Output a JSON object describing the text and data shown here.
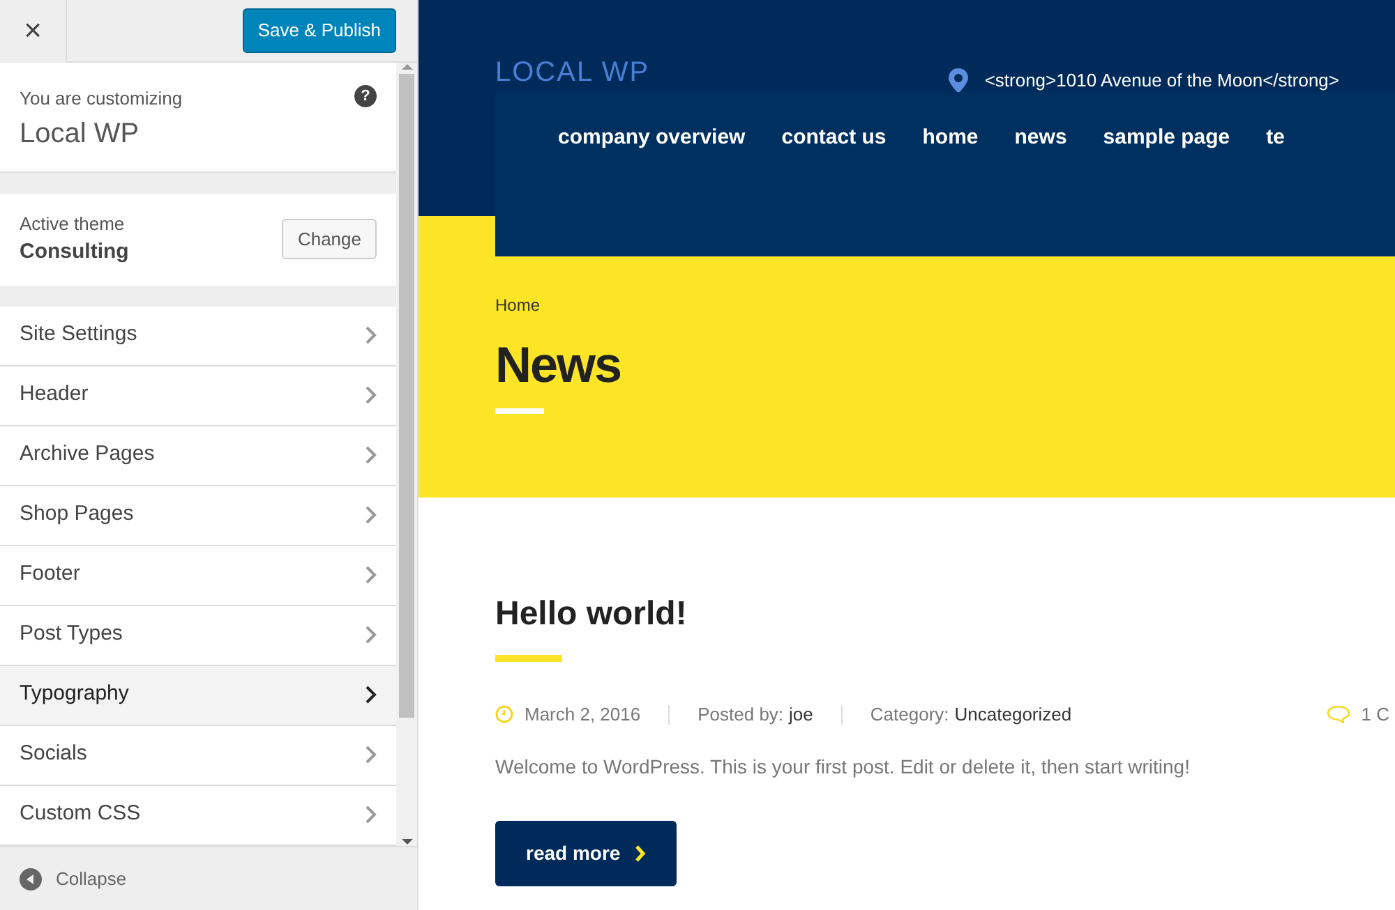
{
  "sidebar": {
    "close": "×",
    "publish_button": "Save & Publish",
    "customizing_label": "You are customizing",
    "site_name": "Local WP",
    "help": "?",
    "theme_label": "Active theme",
    "theme_name": "Consulting",
    "change_button": "Change",
    "items": [
      {
        "label": "Site Settings",
        "selected": false
      },
      {
        "label": "Header",
        "selected": false
      },
      {
        "label": "Archive Pages",
        "selected": false
      },
      {
        "label": "Shop Pages",
        "selected": false
      },
      {
        "label": "Footer",
        "selected": false
      },
      {
        "label": "Post Types",
        "selected": false
      },
      {
        "label": "Typography",
        "selected": true
      },
      {
        "label": "Socials",
        "selected": false
      },
      {
        "label": "Custom CSS",
        "selected": false
      }
    ],
    "collapse": "Collapse"
  },
  "preview": {
    "site_title": "LOCAL WP",
    "address": "<strong>1010 Avenue of the Moon</strong>",
    "nav": [
      "company overview",
      "contact us",
      "home",
      "news",
      "sample page",
      "te"
    ],
    "breadcrumb": "Home",
    "page_title": "News",
    "post": {
      "title": "Hello world!",
      "date": "March 2, 2016",
      "posted_by_label": "Posted by:",
      "author": "joe",
      "category_label": "Category:",
      "category": "Uncategorized",
      "comments": "1 C",
      "excerpt": "Welcome to WordPress. This is your first post. Edit or delete it, then start writing!",
      "read_more": "read more"
    }
  }
}
